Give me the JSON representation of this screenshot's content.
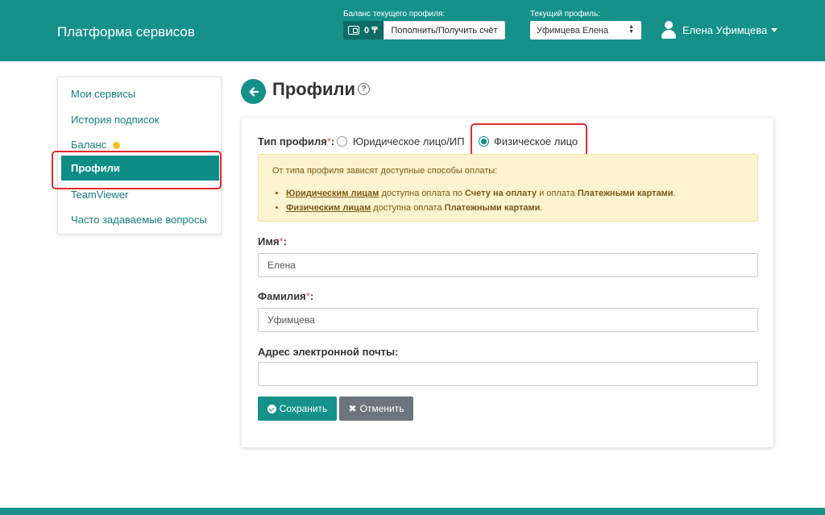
{
  "header": {
    "brand": "Платформа сервисов",
    "balance_label": "Баланс текущего профиля:",
    "balance_value": "0 ₸",
    "topup_label": "Пополнить/Получить счёт",
    "profile_label": "Текущий профиль:",
    "profile_selected": "Уфимцева Елена",
    "user_name": "Елена Уфимцева",
    "accent_color": "#15918a"
  },
  "sidebar": {
    "items": [
      {
        "label": "Мои сервисы"
      },
      {
        "label": "История подписок"
      },
      {
        "label": "Баланс"
      },
      {
        "label": "Профили"
      },
      {
        "label": "TeamViewer"
      },
      {
        "label": "Часто задаваемые вопросы"
      }
    ],
    "active": "Профили"
  },
  "page": {
    "title": "Профили"
  },
  "form": {
    "type_label": "Тип профиля",
    "required_mark": "*",
    "colon": ":",
    "radio_legal": "Юридическое лицо/ИП",
    "radio_individual": "Физическое лицо",
    "selected_type": "Физическое лицо",
    "notice": {
      "intro": "От типа профиля зависят доступные способы оплаты:",
      "line1": {
        "link": "Юридическим лицам",
        "text1": " доступна оплата по ",
        "bold1": "Счету на оплату",
        "text2": " и оплата ",
        "bold2": "Платежными картами",
        "end": "."
      },
      "line2": {
        "link": "Физическим лицам",
        "text1": " доступна оплата ",
        "bold1": "Платежными картами",
        "end": "."
      }
    },
    "first_name": {
      "label": "Имя",
      "value": "Елена"
    },
    "last_name": {
      "label": "Фамилия",
      "value": "Уфимцева"
    },
    "email": {
      "label": "Адрес электронной почты:",
      "value": ""
    },
    "save_label": "Сохранить",
    "cancel_label": "Отменить"
  }
}
